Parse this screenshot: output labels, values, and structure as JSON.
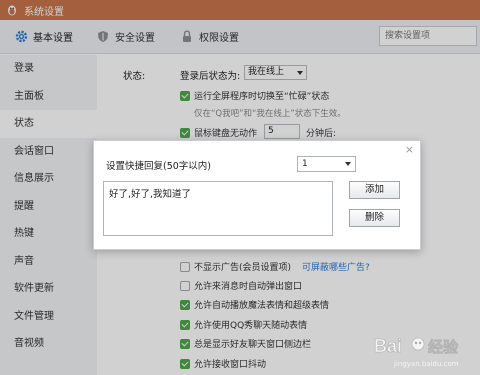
{
  "window": {
    "title": "系统设置"
  },
  "tabs": [
    {
      "label": "基本设置",
      "icon": "gear-icon",
      "active": true
    },
    {
      "label": "安全设置",
      "icon": "shield-icon"
    },
    {
      "label": "权限设置",
      "icon": "lock-icon"
    }
  ],
  "search": {
    "placeholder": "搜索设置项"
  },
  "sidebar": {
    "items": [
      {
        "label": "登录"
      },
      {
        "label": "主面板"
      },
      {
        "label": "状态",
        "active": true
      },
      {
        "label": "会话窗口"
      },
      {
        "label": "信息展示"
      },
      {
        "label": "提醒"
      },
      {
        "label": "热键"
      },
      {
        "label": "声音"
      },
      {
        "label": "软件更新"
      },
      {
        "label": "文件管理"
      },
      {
        "label": "音视频"
      }
    ]
  },
  "status": {
    "section_label": "状态:",
    "login_status_label": "登录后状态为:",
    "login_status_value": "我在线上",
    "fullscreen_busy": {
      "label": "运行全屏程序时切换至“忙碌”状态",
      "checked": true
    },
    "fullscreen_hint": "仅在“Q我吧”和“我在线上”状态下生效。",
    "idle": {
      "label_prefix": "鼠标键盘无动作",
      "value": "5",
      "label_suffix": "分钟后:",
      "checked": true
    },
    "no_ads": {
      "label": "不显示广告(会员设置项)",
      "checked": false
    },
    "ads_link": "可屏蔽哪些广告?",
    "popup": {
      "label": "允许来消息时自动弹出窗口",
      "checked": false
    },
    "magic_face": {
      "label": "允许自动播放魔法表情和超级表情",
      "checked": true
    },
    "qqshow": {
      "label": "允许使用QQ秀聊天随动表情",
      "checked": true
    },
    "friend_sidebar": {
      "label": "总是显示好友聊天窗口侧边栏",
      "checked": true
    },
    "shake": {
      "label": "允许接收窗口抖动",
      "checked": true
    }
  },
  "dialog": {
    "label": "设置快捷回复(50字以内)",
    "index_value": "1",
    "reply_text": "好了,好了,我知道了",
    "add_button": "添加",
    "delete_button": "删除",
    "close_symbol": "×"
  },
  "watermark": {
    "text": "Bai 经验",
    "sub": "jingyan.baidu.com"
  },
  "colors": {
    "titlebar": "#c8764c",
    "accent_green": "#4ea84b",
    "link_blue": "#2f7bd6",
    "tab_icon_blue": "#2f7bd6"
  }
}
